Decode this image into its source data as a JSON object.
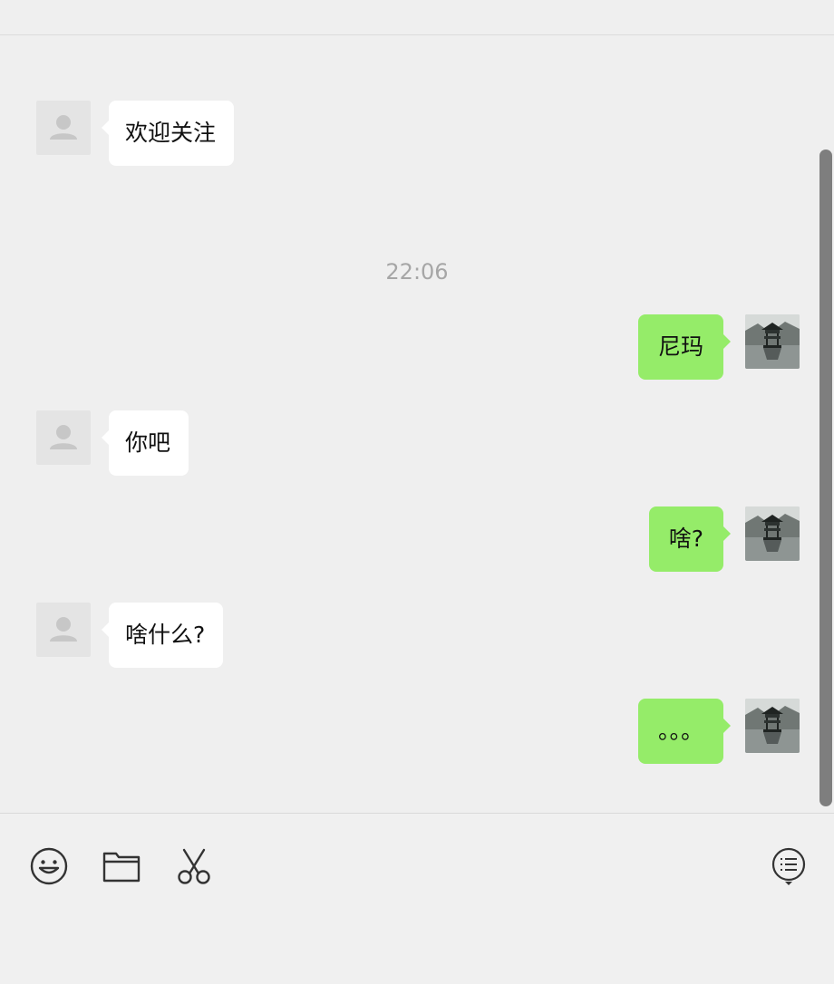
{
  "chat": {
    "timestamp": "22:06",
    "messages": [
      {
        "side": "left",
        "text": "欢迎关注"
      },
      {
        "side": "right",
        "text": "尼玛"
      },
      {
        "side": "left",
        "text": "你吧"
      },
      {
        "side": "right",
        "text": "啥?"
      },
      {
        "side": "left",
        "text": "啥什么?"
      },
      {
        "side": "right",
        "text": "。。。"
      }
    ]
  },
  "toolbar": {
    "icons": [
      "emoji-icon",
      "folder-icon",
      "scissors-icon",
      "chat-history-icon"
    ]
  },
  "colors": {
    "background": "#efefef",
    "incoming_bubble": "#ffffff",
    "outgoing_bubble": "#95ec69",
    "timestamp_text": "#a6a6a6",
    "scrollbar": "#7e7e7e"
  }
}
